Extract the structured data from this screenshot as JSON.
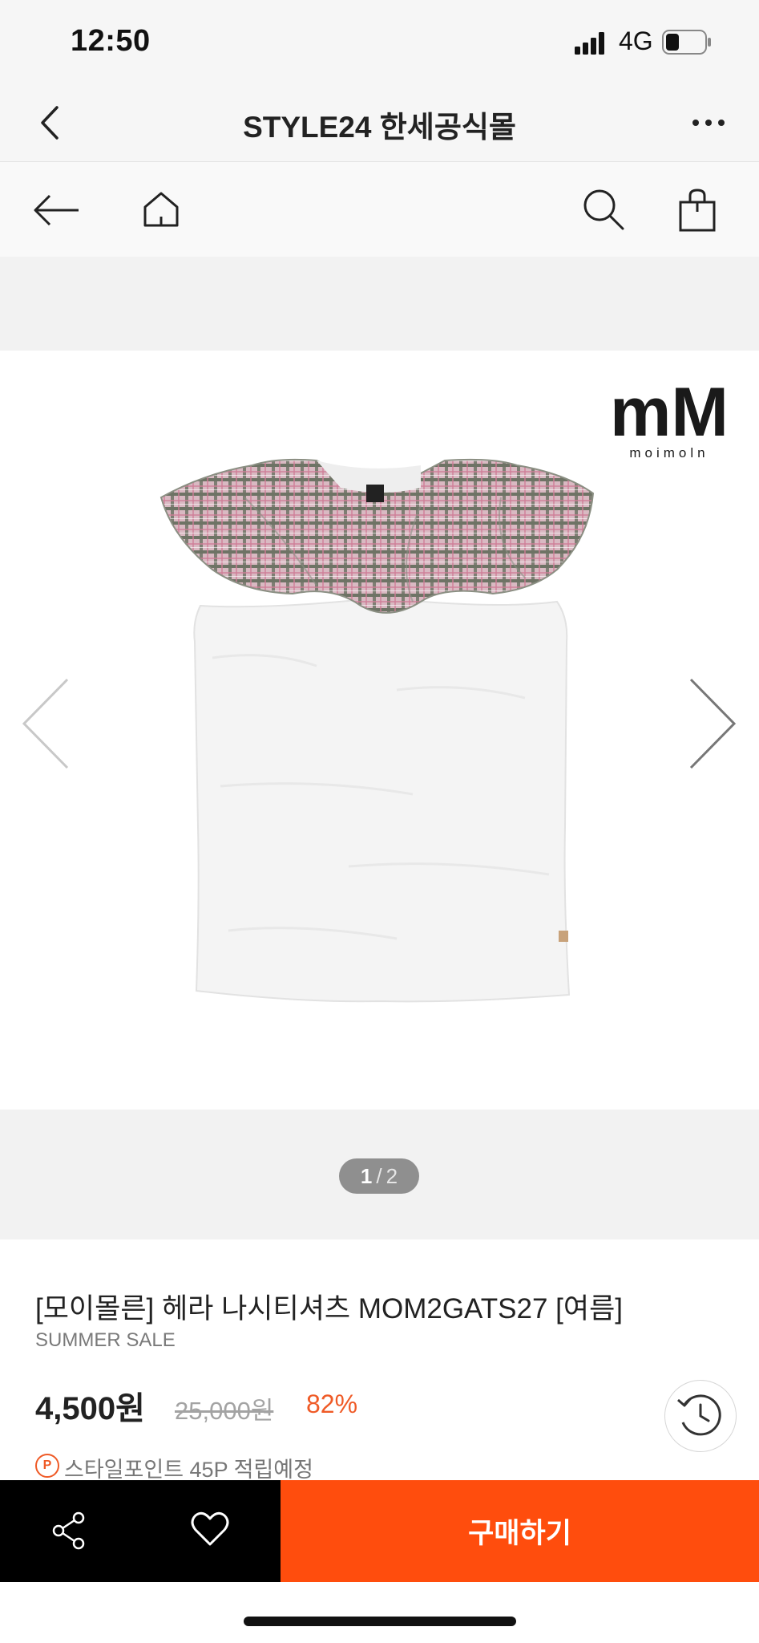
{
  "status_bar": {
    "time": "12:50",
    "network": "4G"
  },
  "title_bar": {
    "title": "STYLE24 한세공식몰"
  },
  "gallery": {
    "brand_logo_text": "mM",
    "brand_logo_subtext": "moimoln",
    "current": "1",
    "separator": "/",
    "total": "2"
  },
  "product": {
    "title": "[모이몰른] 헤라 나시티셔츠 MOM2GATS27 [여름]",
    "sale_label": "SUMMER SALE",
    "price": "4,500원",
    "original_price": "25,000원",
    "discount": "82%",
    "points_icon": "P",
    "points_text": "스타일포인트 45P 적립예정"
  },
  "action_bar": {
    "buy_label": "구매하기"
  },
  "colors": {
    "accent": "#ff4d0d",
    "discount": "#ef5a26",
    "black": "#000000"
  }
}
